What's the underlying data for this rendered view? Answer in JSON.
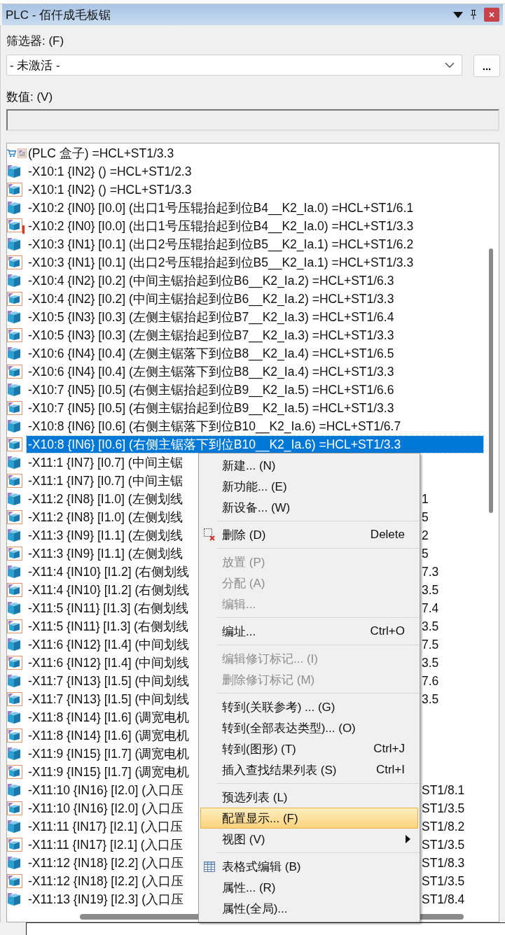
{
  "window": {
    "title": "PLC - 佰仟成毛板锯"
  },
  "filter": {
    "label": "筛选器: (F)",
    "value": "- 未激活 -",
    "more_button": "..."
  },
  "value_field": {
    "label": "数值: (V)"
  },
  "rows": [
    {
      "kind": "box",
      "text": "(PLC 盒子) =HCL+ST1/3.3",
      "selected": false
    },
    {
      "kind": "cube",
      "text": "-X10:1 {IN2} () =HCL+ST1/2.3",
      "selected": false
    },
    {
      "kind": "framed",
      "text": "-X10:1 {IN2} () =HCL+ST1/3.3",
      "selected": false
    },
    {
      "kind": "cube",
      "text": "-X10:2 {IN0} [I0.0] (出口1号压辊抬起到位B4__K2_Ia.0) =HCL+ST1/6.1",
      "selected": false
    },
    {
      "kind": "alert",
      "text": "-X10:2 {IN0} [I0.0] (出口1号压辊抬起到位B4__K2_Ia.0) =HCL+ST1/3.3",
      "selected": false
    },
    {
      "kind": "cube",
      "text": "-X10:3 {IN1} [I0.1] (出口2号压辊抬起到位B5__K2_Ia.1) =HCL+ST1/6.2",
      "selected": false
    },
    {
      "kind": "framed",
      "text": "-X10:3 {IN1} [I0.1] (出口2号压辊抬起到位B5__K2_Ia.1) =HCL+ST1/3.3",
      "selected": false
    },
    {
      "kind": "cube",
      "text": "-X10:4 {IN2} [I0.2] (中间主锯抬起到位B6__K2_Ia.2) =HCL+ST1/6.3",
      "selected": false
    },
    {
      "kind": "framed",
      "text": "-X10:4 {IN2} [I0.2] (中间主锯抬起到位B6__K2_Ia.2) =HCL+ST1/3.3",
      "selected": false
    },
    {
      "kind": "cube",
      "text": "-X10:5 {IN3} [I0.3] (左侧主锯抬起到位B7__K2_Ia.3) =HCL+ST1/6.4",
      "selected": false
    },
    {
      "kind": "framed",
      "text": "-X10:5 {IN3} [I0.3] (左侧主锯抬起到位B7__K2_Ia.3) =HCL+ST1/3.3",
      "selected": false
    },
    {
      "kind": "cube",
      "text": "-X10:6 {IN4} [I0.4] (左侧主锯落下到位B8__K2_Ia.4) =HCL+ST1/6.5",
      "selected": false
    },
    {
      "kind": "framed",
      "text": "-X10:6 {IN4} [I0.4] (左侧主锯落下到位B8__K2_Ia.4) =HCL+ST1/3.3",
      "selected": false
    },
    {
      "kind": "cube",
      "text": "-X10:7 {IN5} [I0.5] (右侧主锯抬起到位B9__K2_Ia.5) =HCL+ST1/6.6",
      "selected": false
    },
    {
      "kind": "framed",
      "text": "-X10:7 {IN5} [I0.5] (右侧主锯抬起到位B9__K2_Ia.5) =HCL+ST1/3.3",
      "selected": false
    },
    {
      "kind": "cube",
      "text": "-X10:8 {IN6} [I0.6] (右侧主锯落下到位B10__K2_Ia.6) =HCL+ST1/6.7",
      "selected": false
    },
    {
      "kind": "framed",
      "text": "-X10:8 {IN6} [I0.6] (右侧主锯落下到位B10__K2_Ia.6) =HCL+ST1/3.3",
      "selected": true
    },
    {
      "kind": "cube",
      "text": "-X11:1 {IN7} [I0.7] (中间主锯",
      "selected": false
    },
    {
      "kind": "framed",
      "text": "-X11:1 {IN7} [I0.7] (中间主锯",
      "selected": false
    },
    {
      "kind": "cube",
      "text": "-X11:2 {IN8} [I1.0] (左侧划线",
      "tail": "1",
      "selected": false
    },
    {
      "kind": "framed",
      "text": "-X11:2 {IN8} [I1.0] (左侧划线",
      "tail": "5",
      "selected": false
    },
    {
      "kind": "cube",
      "text": "-X11:3 {IN9} [I1.1] (左侧划线",
      "tail": "2",
      "selected": false
    },
    {
      "kind": "framed",
      "text": "-X11:3 {IN9} [I1.1] (左侧划线",
      "tail": "5",
      "selected": false
    },
    {
      "kind": "cube",
      "text": "-X11:4 {IN10} [I1.2] (右侧划线",
      "tail": "7.3",
      "selected": false
    },
    {
      "kind": "framed",
      "text": "-X11:4 {IN10} [I1.2] (右侧划线",
      "tail": "3.5",
      "selected": false
    },
    {
      "kind": "cube",
      "text": "-X11:5 {IN11} [I1.3] (右侧划线",
      "tail": "7.4",
      "selected": false
    },
    {
      "kind": "framed",
      "text": "-X11:5 {IN11} [I1.3] (右侧划线",
      "tail": "3.5",
      "selected": false
    },
    {
      "kind": "cube",
      "text": "-X11:6 {IN12} [I1.4] (中间划线",
      "tail": "7.5",
      "selected": false
    },
    {
      "kind": "framed",
      "text": "-X11:6 {IN12} [I1.4] (中间划线",
      "tail": "3.5",
      "selected": false
    },
    {
      "kind": "cube",
      "text": "-X11:7 {IN13} [I1.5] (中间划线",
      "tail": "7.6",
      "selected": false
    },
    {
      "kind": "framed",
      "text": "-X11:7 {IN13} [I1.5] (中间划线",
      "tail": "3.5",
      "selected": false
    },
    {
      "kind": "cube",
      "text": "-X11:8 {IN14} [I1.6] (调宽电机",
      "selected": false
    },
    {
      "kind": "framed",
      "text": "-X11:8 {IN14} [I1.6] (调宽电机",
      "selected": false
    },
    {
      "kind": "cube",
      "text": "-X11:9 {IN15} [I1.7] (调宽电机",
      "selected": false
    },
    {
      "kind": "framed",
      "text": "-X11:9 {IN15} [I1.7] (调宽电机",
      "selected": false
    },
    {
      "kind": "cube",
      "text": "-X11:10 {IN16} [I2.0] (入口压",
      "tail": "ST1/8.1",
      "selected": false
    },
    {
      "kind": "framed",
      "text": "-X11:10 {IN16} [I2.0] (入口压",
      "tail": "ST1/3.5",
      "selected": false
    },
    {
      "kind": "cube",
      "text": "-X11:11 {IN17} [I2.1] (入口压",
      "tail": "ST1/8.2",
      "selected": false
    },
    {
      "kind": "framed",
      "text": "-X11:11 {IN17} [I2.1] (入口压",
      "tail": "ST1/3.5",
      "selected": false
    },
    {
      "kind": "cube",
      "text": "-X11:12 {IN18} [I2.2] (入口压",
      "tail": "ST1/8.3",
      "selected": false
    },
    {
      "kind": "framed",
      "text": "-X11:12 {IN18} [I2.2] (入口压",
      "tail": "ST1/3.5",
      "selected": false
    },
    {
      "kind": "cube",
      "text": "-X11:13 {IN19} [I2.3] (入口压",
      "tail": "ST1/8.4",
      "selected": false
    }
  ],
  "context_menu": {
    "groups": [
      [
        {
          "label": "新建... (N)",
          "disabled": false,
          "selected": false
        },
        {
          "label": "新功能... (E)",
          "disabled": false,
          "selected": false
        },
        {
          "label": "新设备... (W)",
          "disabled": false,
          "selected": false
        }
      ],
      [
        {
          "label": "删除 (D)",
          "shortcut": "Delete",
          "kind": "delete",
          "disabled": false,
          "selected": false
        }
      ],
      [
        {
          "label": "放置 (P)",
          "disabled": true,
          "selected": false
        },
        {
          "label": "分配 (A)",
          "disabled": true,
          "selected": false
        },
        {
          "label": "编辑...",
          "disabled": true,
          "selected": false
        }
      ],
      [
        {
          "label": "编址...",
          "shortcut": "Ctrl+O",
          "disabled": false,
          "selected": false
        }
      ],
      [
        {
          "label": "编辑修订标记... (I)",
          "disabled": true,
          "selected": false
        },
        {
          "label": "删除修订标记 (M)",
          "disabled": true,
          "selected": false
        }
      ],
      [
        {
          "label": "转到(关联参考) ... (G)",
          "disabled": false,
          "selected": false
        },
        {
          "label": "转到(全部表达类型)... (O)",
          "disabled": false,
          "selected": false
        },
        {
          "label": "转到(图形) (T)",
          "shortcut": "Ctrl+J",
          "disabled": false,
          "selected": false
        },
        {
          "label": "插入查找结果列表 (S)",
          "shortcut": "Ctrl+I",
          "disabled": false,
          "selected": false
        }
      ],
      [
        {
          "label": "预选列表 (L)",
          "disabled": false,
          "selected": false
        },
        {
          "label": "配置显示... (F)",
          "disabled": false,
          "selected": true
        },
        {
          "label": "视图 (V)",
          "submenu": true,
          "disabled": false,
          "selected": false
        }
      ],
      [
        {
          "label": "表格式编辑 (B)",
          "kind": "table",
          "disabled": false,
          "selected": false
        },
        {
          "label": "属性... (R)",
          "disabled": false,
          "selected": false
        },
        {
          "label": "属性(全局)...",
          "disabled": false,
          "selected": false
        }
      ]
    ]
  }
}
